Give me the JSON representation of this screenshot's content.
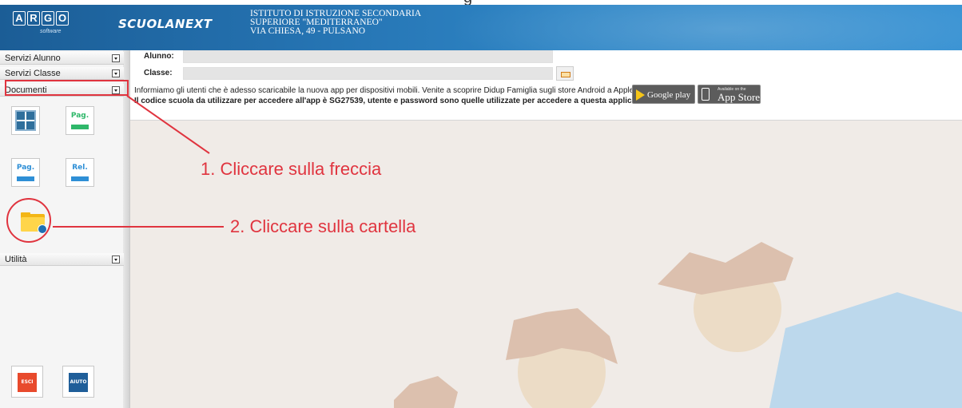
{
  "header": {
    "brand": {
      "letters": [
        "A",
        "R",
        "G",
        "O"
      ],
      "sub": "software"
    },
    "product": "SCUOLANEXT",
    "school": [
      "ISTITUTO DI ISTRUZIONE SECONDARIA",
      "SUPERIORE \"MEDITERRANEO\"",
      "VIA CHIESA, 49 - PULSANO"
    ],
    "top_cut_text": "g"
  },
  "sidebar": {
    "sections": [
      {
        "label": "Servizi Alunno"
      },
      {
        "label": "Servizi Classe"
      },
      {
        "label": "Documenti"
      },
      {
        "label": "Utilità"
      }
    ],
    "tiles": [
      {
        "label": "",
        "icon": "grid-window-icon"
      },
      {
        "label": "Pag.",
        "icon": "page-icon",
        "bar_color": "#2fb86a"
      },
      {
        "label": "Pag.",
        "icon": "page-icon",
        "bar_color": "#2e8fd6"
      },
      {
        "label": "Rel.",
        "icon": "report-icon",
        "bar_color": "#2e8fd6"
      },
      {
        "label": "",
        "icon": "folder-user-icon"
      }
    ],
    "bottom_buttons": [
      {
        "label": "ESCI",
        "color": "#e84a2c"
      },
      {
        "label": "AIUTO",
        "color": "#1f5e99"
      }
    ]
  },
  "main": {
    "fields": [
      {
        "label": "Alunno:",
        "value": ""
      },
      {
        "label": "Classe:",
        "value": ""
      }
    ],
    "info_line_1": "Informiamo gli utenti che è adesso scaricabile la nuova app per dispositivi mobili. Venite a scoprire Didup Famiglia sugli store Android a Apple!",
    "info_line_2": "Il codice scuola da utilizzare per accedere all'app è SG27539, utente e password sono quelle utilizzate per accedere a questa applicazione.",
    "stores": [
      {
        "small": "",
        "big": "Google play"
      },
      {
        "small": "Available on the",
        "big": "App Store"
      }
    ]
  },
  "annotations": {
    "step1": "1. Cliccare sulla freccia",
    "step2": "2. Cliccare sulla cartella",
    "color": "#e0343f"
  },
  "colors": {
    "header_blue": "#2675b4",
    "accent_red": "#e0343f"
  }
}
